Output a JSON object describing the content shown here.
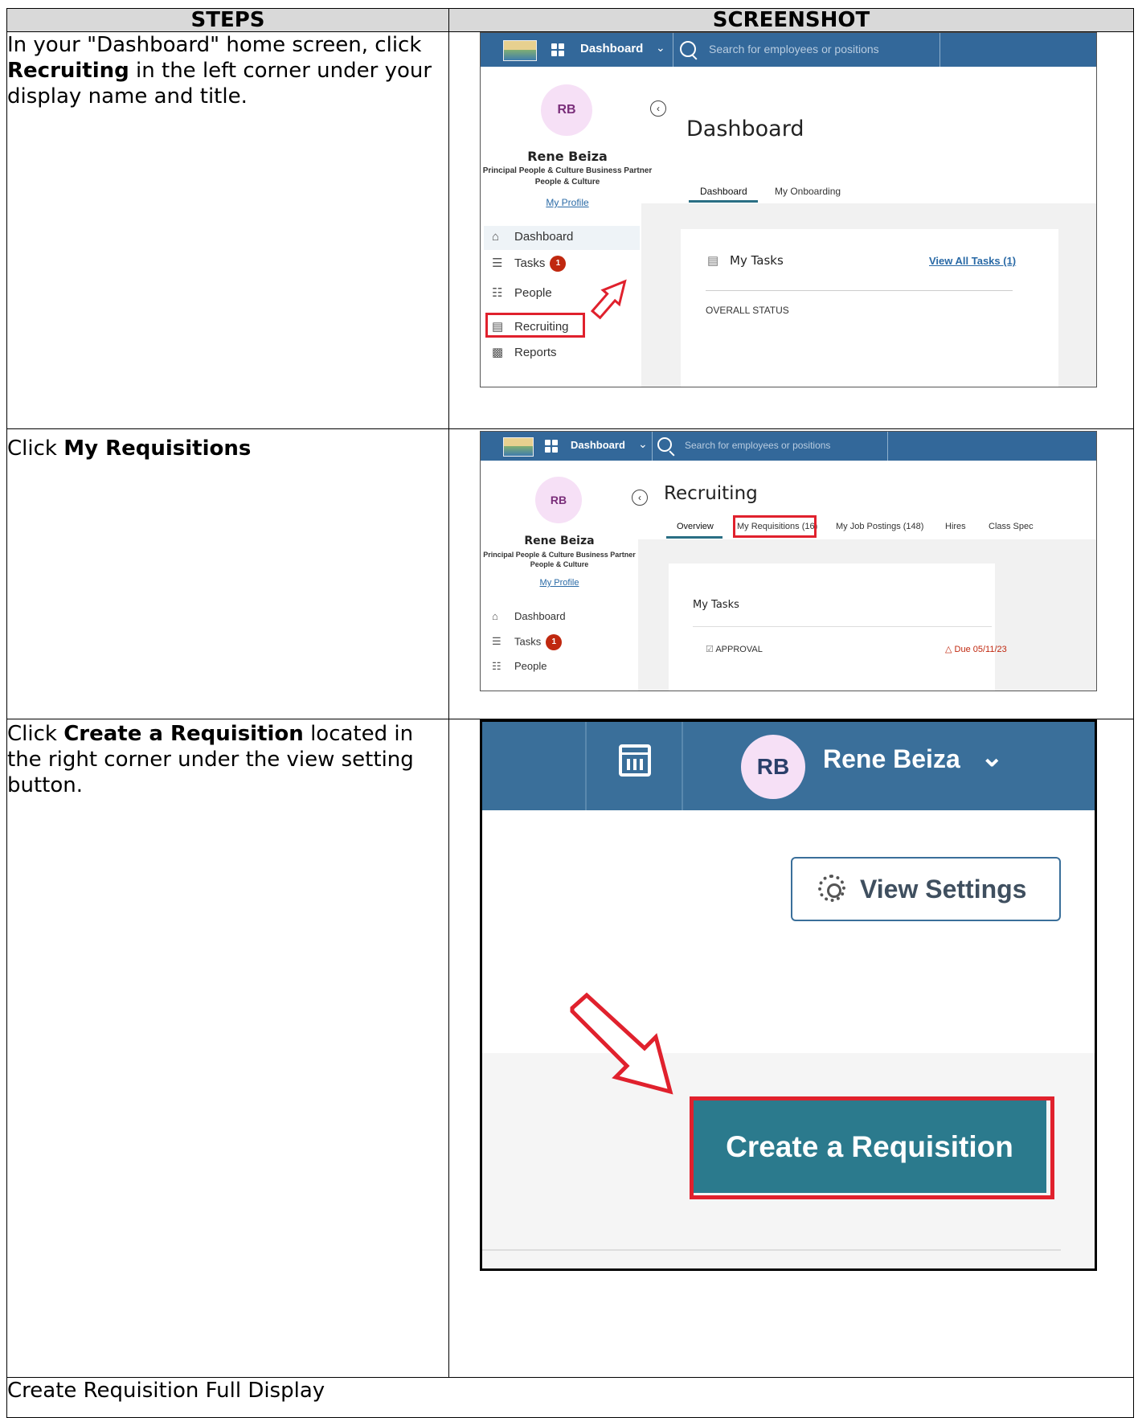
{
  "headers": {
    "steps": "STEPS",
    "screenshot": "SCREENSHOT"
  },
  "steps": {
    "s1_a": "In your \"Dashboard\" home screen, click ",
    "s1_b": "Recruiting",
    "s1_c": " in the left corner under your display name and title.",
    "s2_a": "Click ",
    "s2_b": "My Requisitions",
    "s3_a": "Click ",
    "s3_b": "Create a Requisition",
    "s3_c": " located in the right corner under the view setting button.",
    "s4": "Create Requisition Full Display"
  },
  "shot1": {
    "nav_title": "Dashboard",
    "search_placeholder": "Search for employees or positions",
    "avatar": "RB",
    "user_name": "Rene Beiza",
    "user_title": "Principal People & Culture Business Partner",
    "user_dept": "People & Culture",
    "profile_link": "My Profile",
    "page_title": "Dashboard",
    "tabs": [
      "Dashboard",
      "My Onboarding"
    ],
    "nav": [
      "Dashboard",
      "Tasks",
      "People",
      "Recruiting",
      "Reports"
    ],
    "tasks_badge": "1",
    "card_title": "My Tasks",
    "view_all": "View All Tasks (1)",
    "overall": "OVERALL STATUS"
  },
  "shot2": {
    "nav_title": "Dashboard",
    "search_placeholder": "Search for employees or positions",
    "avatar": "RB",
    "user_name": "Rene Beiza",
    "user_title": "Principal People & Culture Business Partner",
    "user_dept": "People & Culture",
    "profile_link": "My Profile",
    "page_title": "Recruiting",
    "tabs": [
      "Overview",
      "My Requisitions (16)",
      "My Job Postings (148)",
      "Hires",
      "Class Spec"
    ],
    "nav": [
      "Dashboard",
      "Tasks",
      "People"
    ],
    "tasks_badge": "1",
    "card_title": "My Tasks",
    "approval": "APPROVAL",
    "due": "Due 05/11/23"
  },
  "shot3": {
    "avatar": "RB",
    "user_name": "Rene Beiza",
    "view_settings": "View Settings",
    "create_button": "Create a Requisition"
  }
}
